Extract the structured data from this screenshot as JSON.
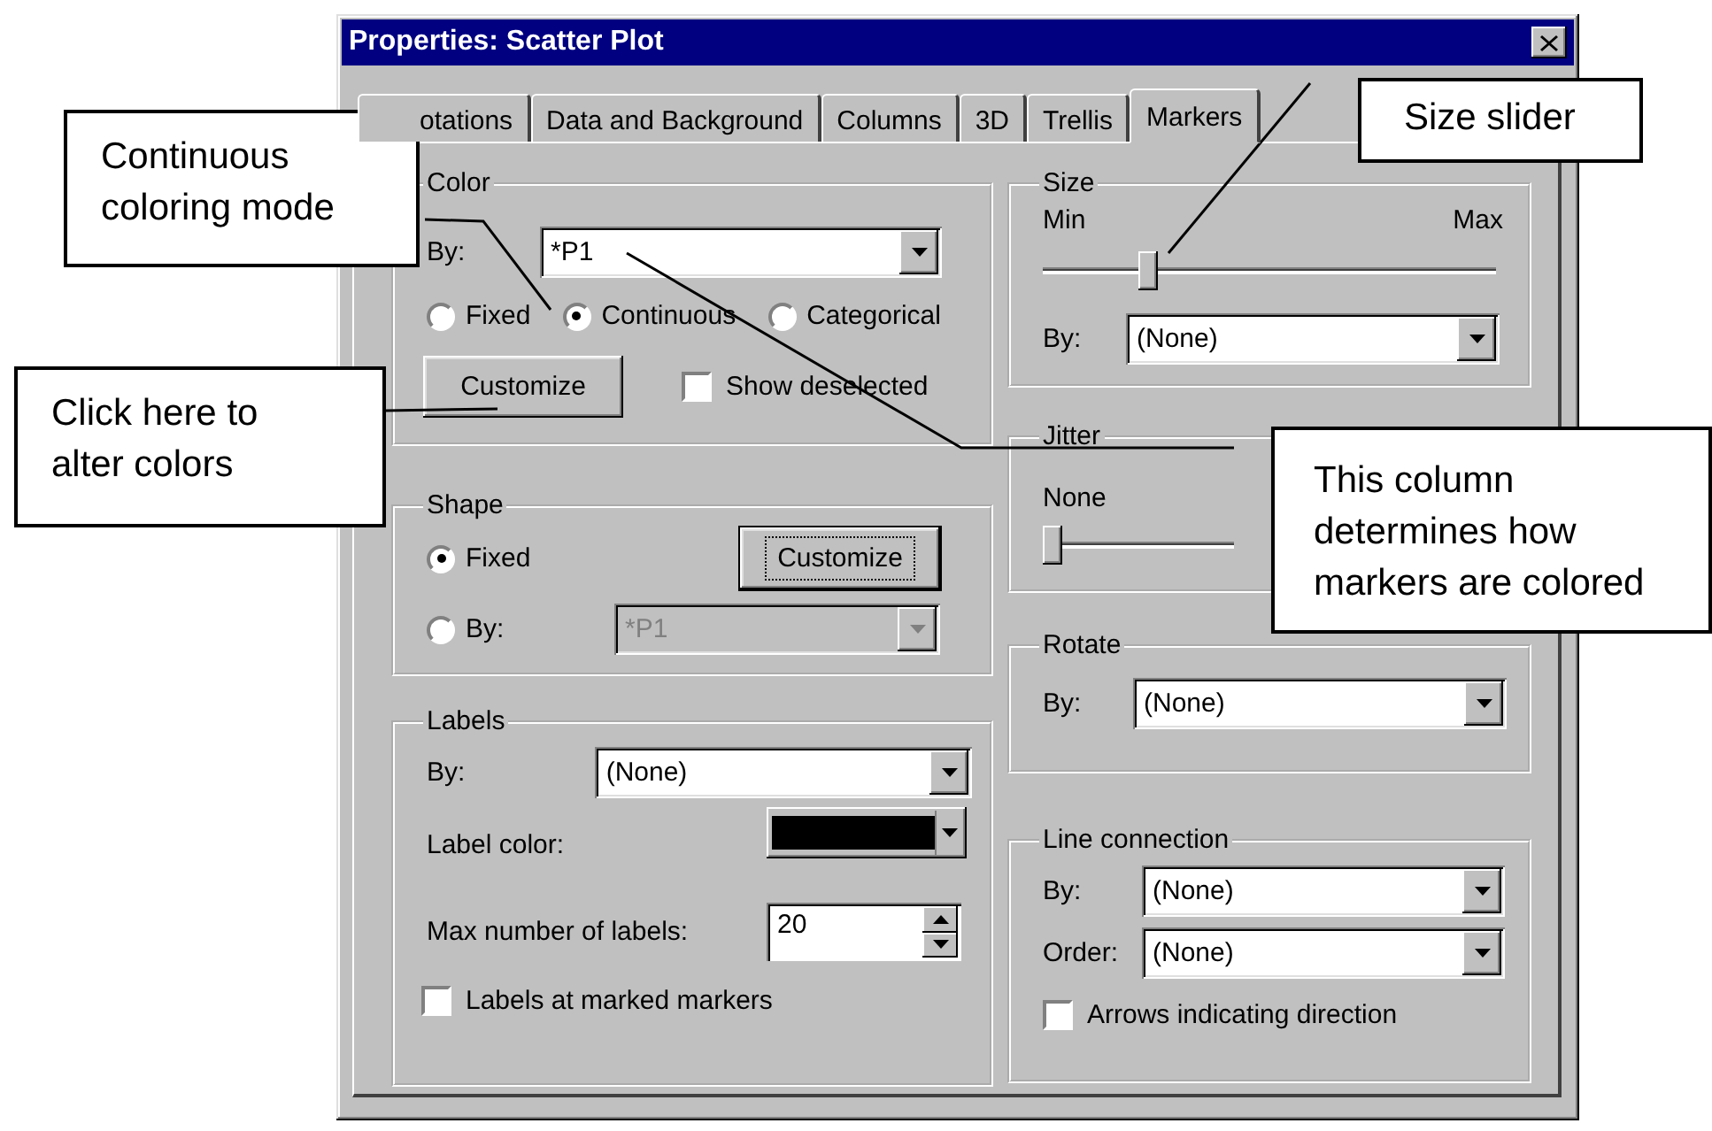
{
  "window": {
    "title": "Properties: Scatter Plot"
  },
  "tabs": [
    {
      "label": "otations",
      "selected": false
    },
    {
      "label": "Data and Background",
      "selected": false
    },
    {
      "label": "Columns",
      "selected": false
    },
    {
      "label": "3D",
      "selected": false
    },
    {
      "label": "Trellis",
      "selected": false
    },
    {
      "label": "Markers",
      "selected": true
    }
  ],
  "color": {
    "title": "Color",
    "by_label": "By:",
    "by_value": "*P1",
    "modes": [
      {
        "label": "Fixed",
        "selected": false
      },
      {
        "label": "Continuous",
        "selected": true
      },
      {
        "label": "Categorical",
        "selected": false
      }
    ],
    "customize": "Customize",
    "show_deselected": {
      "label": "Show deselected",
      "checked": false
    }
  },
  "shape": {
    "title": "Shape",
    "options": [
      {
        "label": "Fixed",
        "selected": true
      },
      {
        "label": "By:",
        "selected": false
      }
    ],
    "by_value": "*P1",
    "by_disabled": true,
    "customize": "Customize",
    "customize_focused": true
  },
  "labels": {
    "title": "Labels",
    "by_label": "By:",
    "by_value": "(None)",
    "color_label": "Label color:",
    "color": "#000000",
    "max_label": "Max number of labels:",
    "max_value": "20",
    "marked": {
      "label": "Labels at marked markers",
      "checked": false
    }
  },
  "size": {
    "title": "Size",
    "min": "Min",
    "max": "Max",
    "level": 0.22,
    "by_label": "By:",
    "by_value": "(None)"
  },
  "jitter": {
    "title": "Jitter",
    "min": "None",
    "level": 0
  },
  "rotate": {
    "title": "Rotate",
    "by_label": "By:",
    "by_value": "(None)"
  },
  "line_connection": {
    "title": "Line connection",
    "by_label": "By:",
    "by_value": "(None)",
    "order_label": "Order:",
    "order_value": "(None)",
    "arrows": {
      "label": "Arrows indicating direction",
      "checked": false
    }
  },
  "callouts": [
    {
      "text": "Continuous coloring mode"
    },
    {
      "text": "Click here to alter colors"
    },
    {
      "text": "Size slider"
    },
    {
      "text": "This column determines how markers are colored"
    }
  ]
}
